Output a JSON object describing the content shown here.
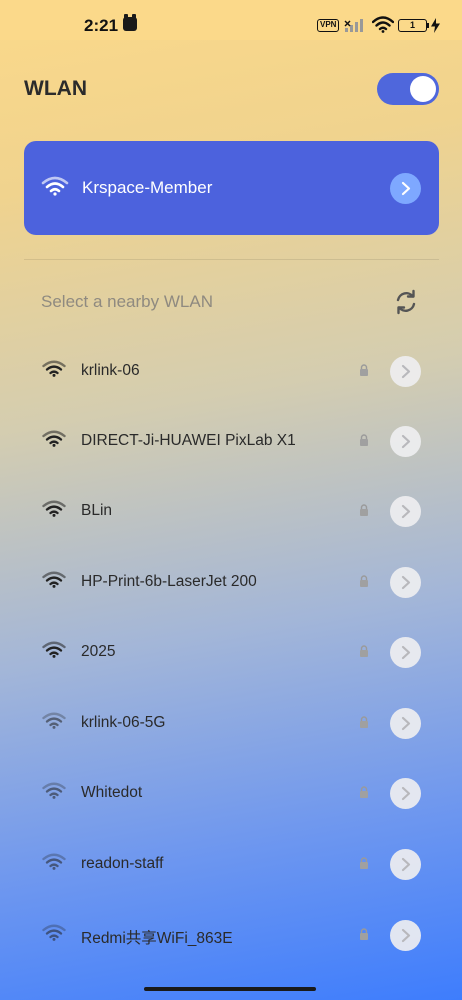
{
  "status_bar": {
    "time": "2:21",
    "vpn_label": "VPN",
    "battery_level": "1"
  },
  "wlan": {
    "title": "WLAN",
    "enabled": true,
    "accent_color": "#4c62dd"
  },
  "connected": {
    "name": "Krspace-Member"
  },
  "nearby": {
    "label": "Select a nearby WLAN",
    "networks": [
      {
        "name": "krlink-06",
        "secured": true
      },
      {
        "name": "DIRECT-Ji-HUAWEI PixLab X1",
        "secured": true
      },
      {
        "name": "BLin",
        "secured": true
      },
      {
        "name": "HP-Print-6b-LaserJet 200",
        "secured": true
      },
      {
        "name": "2025",
        "secured": true
      },
      {
        "name": "krlink-06-5G",
        "secured": true
      },
      {
        "name": "Whitedot",
        "secured": true
      },
      {
        "name": "readon-staff",
        "secured": true
      },
      {
        "name": "Redmi共享WiFi_863E",
        "secured": true
      }
    ]
  }
}
